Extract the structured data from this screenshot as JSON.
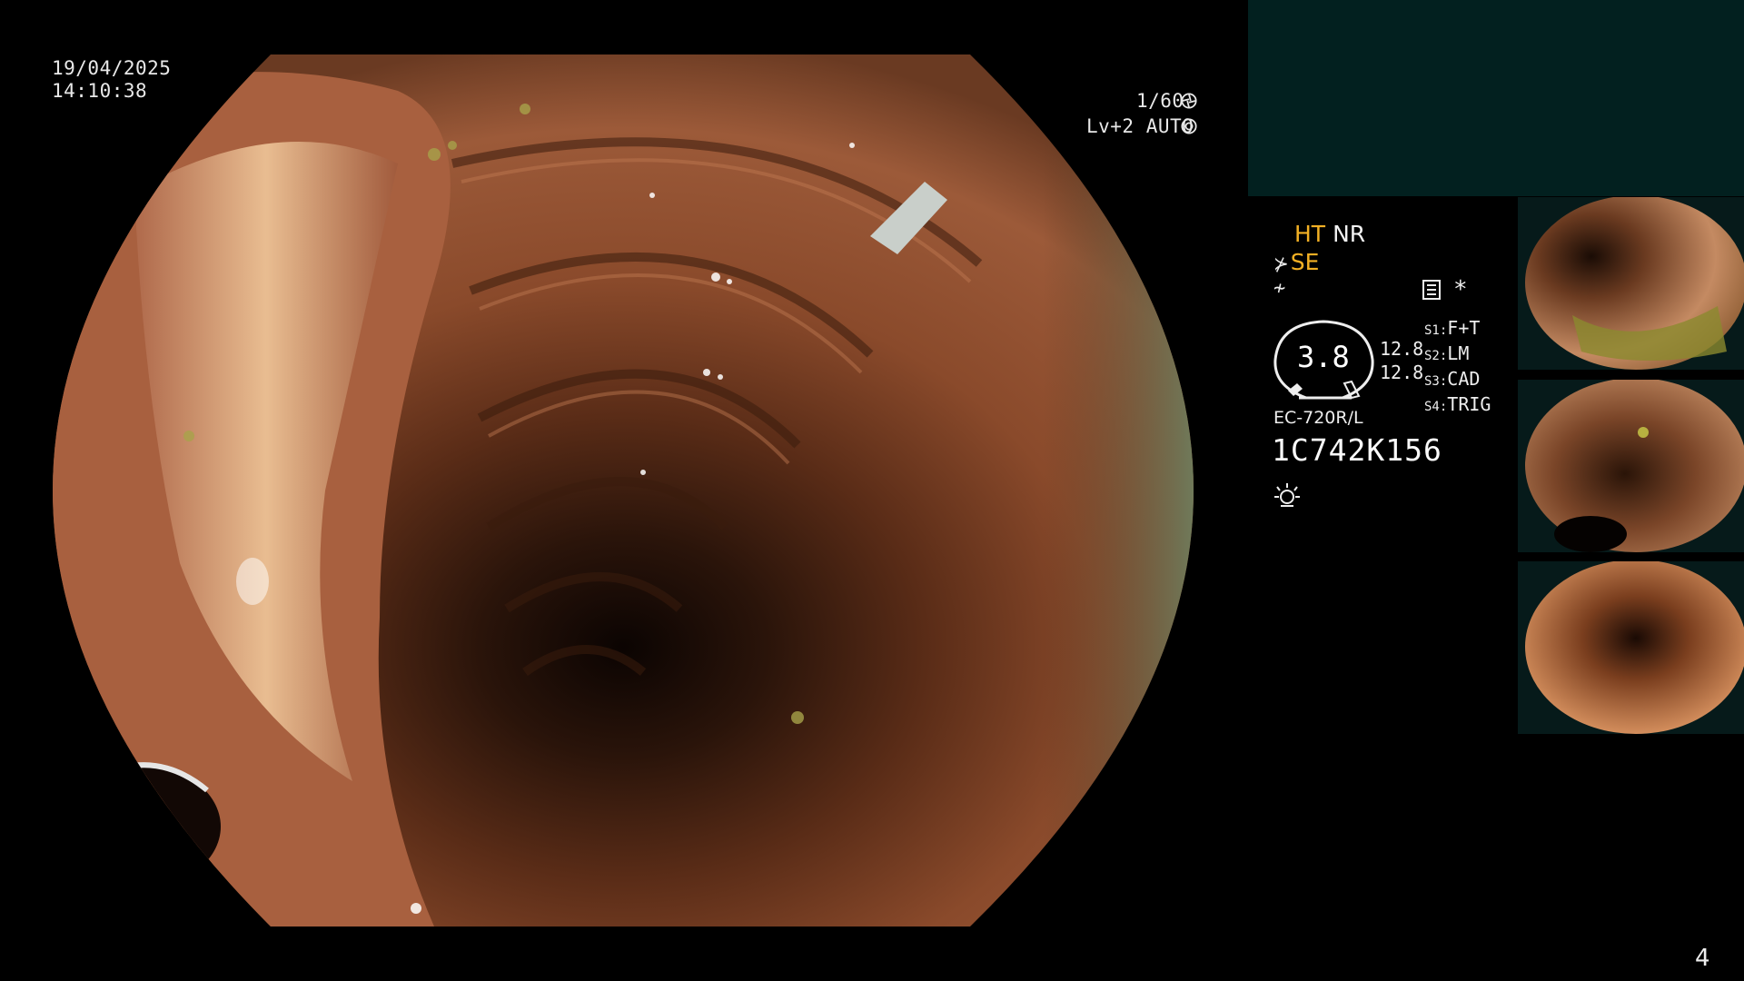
{
  "datetime": {
    "date": "19/04/2025",
    "time": "14:10:38"
  },
  "camera": {
    "shutter": "1/60",
    "iris": "Lv+2 AUTO",
    "shutter_icon": "shutter-icon",
    "iris_icon": "iris-icon"
  },
  "status": {
    "ht": "HT",
    "nr": "NR",
    "se": "SE",
    "highlight_color": "#f2b024"
  },
  "gauge": {
    "value": "3.8"
  },
  "resolution": {
    "line1": "12.8",
    "line2": "12.8"
  },
  "modes": [
    {
      "key": "S1:",
      "value": "F+T"
    },
    {
      "key": "S2:",
      "value": "LM"
    },
    {
      "key": "S3:",
      "value": "CAD"
    },
    {
      "key": "S4:",
      "value": "TRIG"
    }
  ],
  "scope": {
    "model": "EC-720R/L",
    "serial": "1C742K156"
  },
  "page_number": "4",
  "colors": {
    "panel": "#02201f",
    "background": "#000000"
  }
}
